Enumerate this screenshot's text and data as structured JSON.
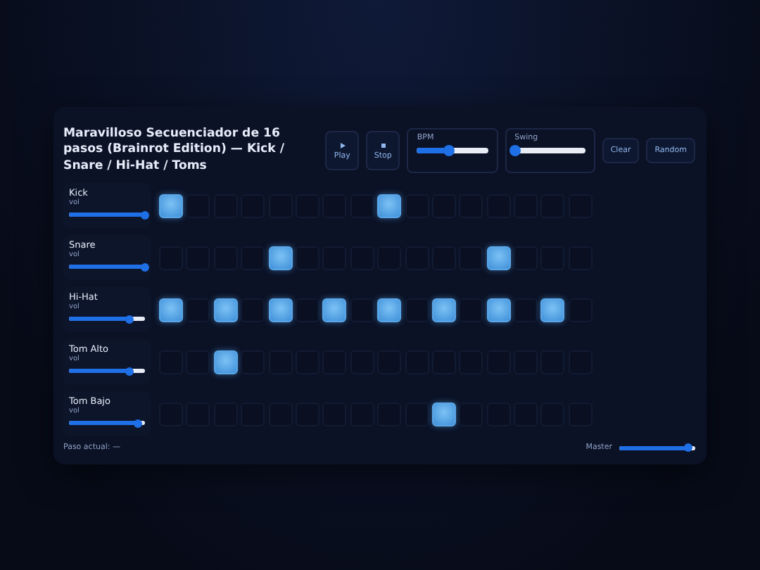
{
  "title": "Maravilloso Secuenciador de 16 pasos (Brainrot Edition) — Kick / Snare / Hi-Hat / Toms",
  "transport": [
    {
      "kind": "play",
      "label": "Play"
    },
    {
      "kind": "stop",
      "label": "Stop"
    }
  ],
  "sliders": [
    {
      "label": "BPM",
      "level": 0.45
    },
    {
      "label": "Swing",
      "level": 0.0
    }
  ],
  "actions": [
    "Clear",
    "Random"
  ],
  "tracks": [
    {
      "name": "Kick",
      "vol_label": "vol",
      "level": 1.0,
      "steps": [
        true,
        false,
        false,
        false,
        false,
        false,
        false,
        false,
        true,
        false,
        false,
        false,
        false,
        false,
        false,
        false
      ]
    },
    {
      "name": "Snare",
      "vol_label": "vol",
      "level": 1.0,
      "steps": [
        false,
        false,
        false,
        false,
        true,
        false,
        false,
        false,
        false,
        false,
        false,
        false,
        true,
        false,
        false,
        false
      ]
    },
    {
      "name": "Hi-Hat",
      "vol_label": "vol",
      "level": 0.8,
      "steps": [
        true,
        false,
        true,
        false,
        true,
        false,
        true,
        false,
        true,
        false,
        true,
        false,
        true,
        false,
        true,
        false
      ]
    },
    {
      "name": "Tom Alto",
      "vol_label": "vol",
      "level": 0.8,
      "steps": [
        false,
        false,
        true,
        false,
        false,
        false,
        false,
        false,
        false,
        false,
        false,
        false,
        false,
        false,
        false,
        false
      ]
    },
    {
      "name": "Tom Bajo",
      "vol_label": "vol",
      "level": 0.9,
      "steps": [
        false,
        false,
        false,
        false,
        false,
        false,
        false,
        false,
        false,
        false,
        true,
        false,
        false,
        false,
        false,
        false
      ]
    }
  ],
  "footer": {
    "step_text": "Paso actual: —",
    "master_label": "Master",
    "master": {
      "level": 0.9
    }
  }
}
